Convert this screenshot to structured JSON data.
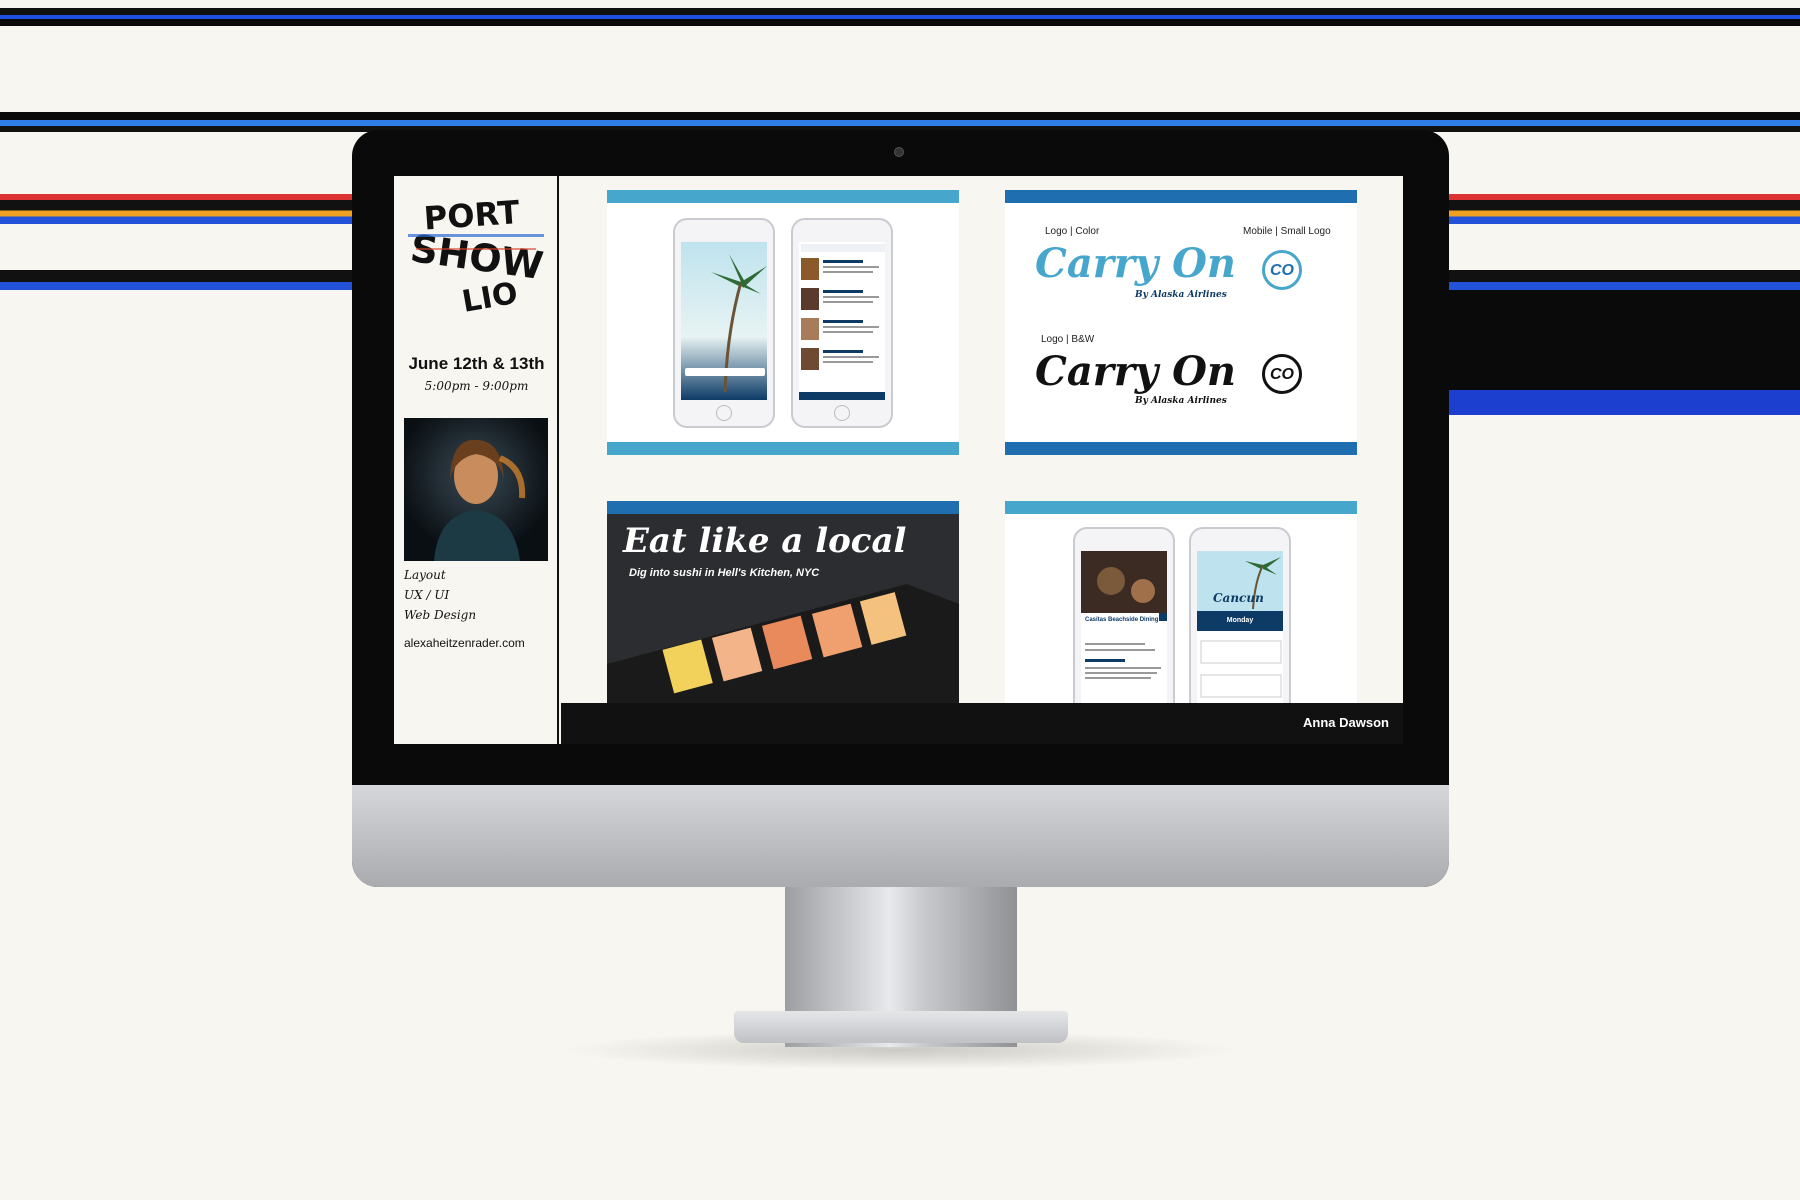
{
  "sidebar": {
    "logo_lines": [
      "PORT",
      "SHOW",
      "LIO"
    ],
    "date": "June 12th & 13th",
    "time": "5:00pm - 9:00pm",
    "skills": [
      "Layout",
      "UX / UI",
      "Web Design"
    ],
    "website": "alexaheitzenrader.com"
  },
  "cards": {
    "carry_on": {
      "logo_color_label": "Logo | Color",
      "mobile_logo_label": "Mobile | Small Logo",
      "logo_bw_label": "Logo | B&W",
      "brand_name": "Carry On",
      "brand_sub": "By Alaska Airlines",
      "small_logo": "CO"
    },
    "eat_local": {
      "headline": "Eat like a local",
      "subline": "Dig into sushi in Hell's Kitchen, NYC"
    },
    "cancun_app": {
      "title": "Cancun",
      "list_item": "Casitas Beachside Dining",
      "day": "Monday"
    }
  },
  "footer": {
    "name": "Anna Dawson"
  },
  "colors": {
    "accent_light_blue": "#47a6cc",
    "accent_dark_blue": "#1f6fb0",
    "navy": "#0d3b66"
  }
}
